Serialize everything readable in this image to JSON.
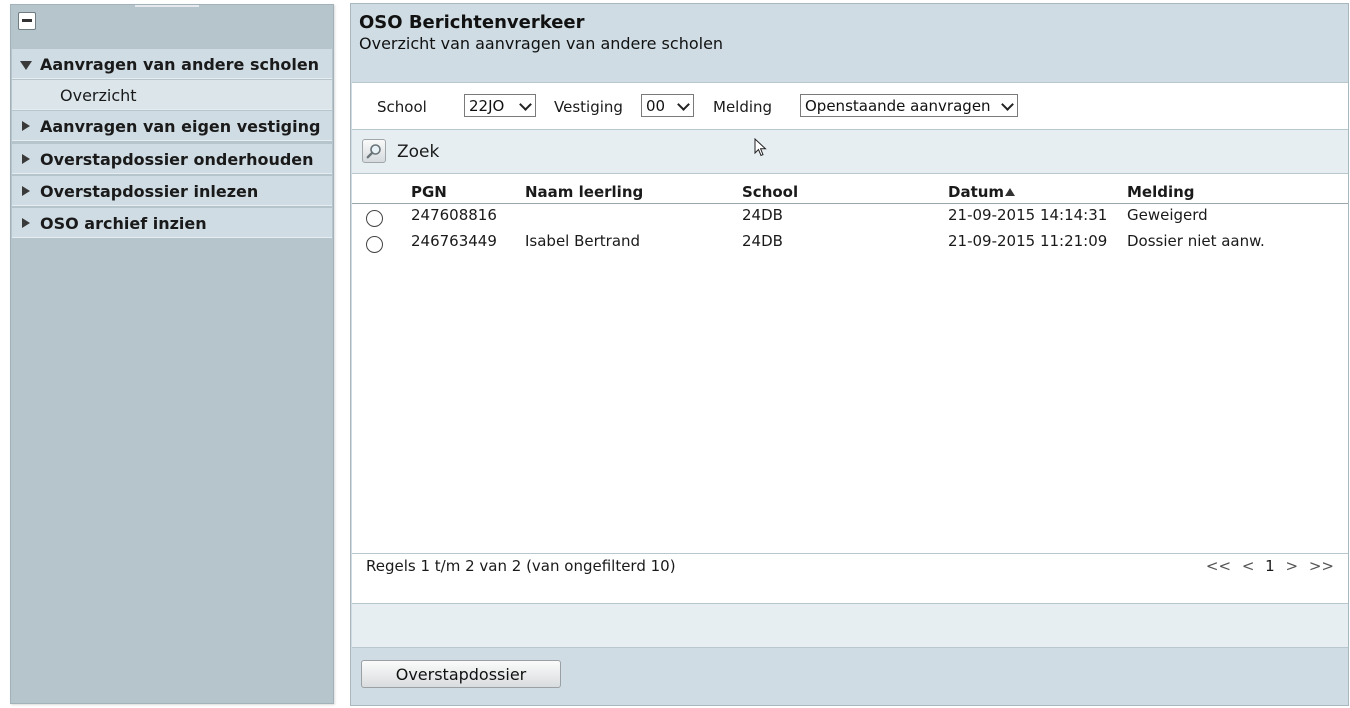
{
  "sidebar": {
    "sections": [
      {
        "label": "Aanvragen van andere scholen",
        "expanded": true,
        "items": [
          {
            "label": "Overzicht"
          }
        ]
      },
      {
        "label": "Aanvragen van eigen vestiging",
        "expanded": false
      },
      {
        "label": "Overstapdossier onderhouden",
        "expanded": false
      },
      {
        "label": "Overstapdossier inlezen",
        "expanded": false
      },
      {
        "label": "OSO archief inzien",
        "expanded": false
      }
    ]
  },
  "header": {
    "title": "OSO Berichtenverkeer",
    "subtitle": "Overzicht van aanvragen van andere scholen"
  },
  "filters": {
    "school_label": "School",
    "school_value": "22JO",
    "vestiging_label": "Vestiging",
    "vestiging_value": "00",
    "melding_label": "Melding",
    "melding_value": "Openstaande aanvragen"
  },
  "search": {
    "label": "Zoek"
  },
  "table": {
    "columns": [
      "PGN",
      "Naam leerling",
      "School",
      "Datum",
      "Melding"
    ],
    "sort_column": "Datum",
    "rows": [
      {
        "pgn": "247608816",
        "naam": "",
        "school": "24DB",
        "datum": "21-09-2015 14:14:31",
        "melding": "Geweigerd"
      },
      {
        "pgn": "246763449",
        "naam": "Isabel Bertrand",
        "school": "24DB",
        "datum": "21-09-2015 11:21:09",
        "melding": "Dossier niet aanw."
      }
    ]
  },
  "pager": {
    "info": "Regels 1 t/m 2 van 2 (van ongefilterd 10)",
    "first": "<<",
    "prev": "<",
    "current": "1",
    "next": ">",
    "last": ">>"
  },
  "actions": {
    "overstapdossier_label": "Overstapdossier"
  },
  "icons": {
    "collapse": "minus-icon",
    "search": "magnifier-icon",
    "cursor": "mouse-pointer-icon"
  }
}
